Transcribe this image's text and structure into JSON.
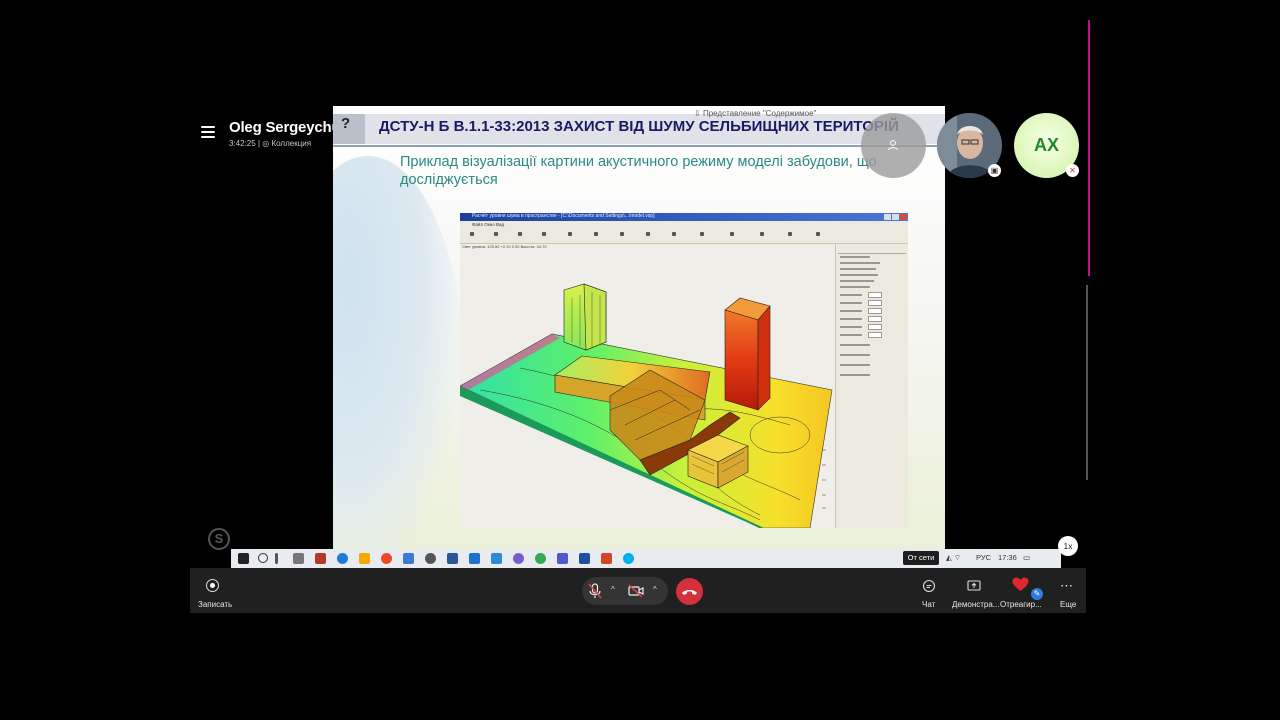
{
  "header": {
    "user_name": "Oleg Sergeychuk",
    "call_timer": "3:42:25",
    "separator": "|",
    "collection_label": "Коллекция"
  },
  "slide": {
    "title": "ДСТУ-Н Б В.1.1-33:2013  ЗАХИСТ ВІД ШУМУ СЕЛЬБИЩНИХ ТЕРИТОРІЙ",
    "subtitle": "Приклад візуалізації картини акустичного режиму моделі забудови, що досліджується",
    "presentation_label": "Представление \"Содержимое\"",
    "app_window_title": "Расчёт уровня шума в пространстве - [C:\\Documents and Settings\\...\\model.vsp]",
    "app_menu": "Файл   Окно   Вид",
    "app_status": "Свет уровня:   125.50     +2.19      2.00      Высота:   44.70"
  },
  "participants": [
    {
      "name": "self-video"
    },
    {
      "name": "AX",
      "initials": "AX"
    }
  ],
  "taskbar": {
    "offline_label": "От сети",
    "language": "РУС",
    "time": "17:36"
  },
  "playback_speed": "1x",
  "controls": {
    "record_label": "Записать",
    "chat_label": "Чат",
    "share_label": "Демонстра...",
    "react_label": "Отреагир...",
    "more_label": "Еще"
  },
  "colors": {
    "accent_end_call": "#d4313a",
    "pink_indicator": "#c10f8a",
    "ax_avatar_text": "#1e8a2c",
    "slide_title": "#1a1a66",
    "slide_subtitle": "#2a8a86"
  }
}
